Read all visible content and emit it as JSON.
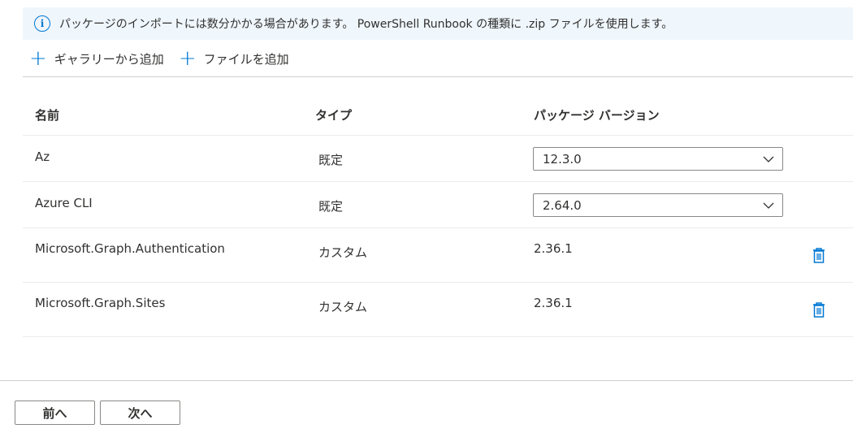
{
  "info": {
    "icon": "info-icon",
    "text": "パッケージのインポートには数分かかる場合があります。 PowerShell Runbook の種類に .zip ファイルを使用します。"
  },
  "toolbar": {
    "add_gallery": "ギャラリーから追加",
    "add_file": "ファイルを追加"
  },
  "table": {
    "headers": {
      "name": "名前",
      "type": "タイプ",
      "version": "パッケージ バージョン"
    },
    "rows": [
      {
        "name": "Az",
        "type": "既定",
        "version": "12.3.0"
      },
      {
        "name": "Azure CLI",
        "type": "既定",
        "version": "2.64.0"
      },
      {
        "name": "Microsoft.Graph.Authentication",
        "type": "カスタム",
        "version": "2.36.1"
      },
      {
        "name": "Microsoft.Graph.Sites",
        "type": "カスタム",
        "version": "2.36.1"
      }
    ]
  },
  "footer": {
    "prev": "前へ",
    "next": "次へ"
  },
  "colors": {
    "accent": "#0078d4",
    "info_bg": "#eff6fc"
  }
}
